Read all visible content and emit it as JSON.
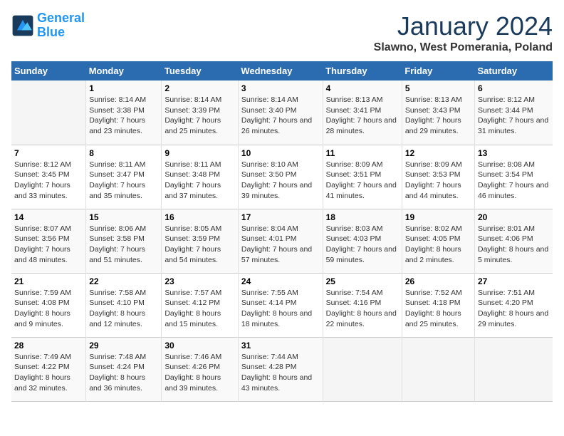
{
  "logo": {
    "line1": "General",
    "line2": "Blue"
  },
  "title": "January 2024",
  "location": "Slawno, West Pomerania, Poland",
  "days_of_week": [
    "Sunday",
    "Monday",
    "Tuesday",
    "Wednesday",
    "Thursday",
    "Friday",
    "Saturday"
  ],
  "weeks": [
    [
      {
        "day": "",
        "sunrise": "",
        "sunset": "",
        "daylight": ""
      },
      {
        "day": "1",
        "sunrise": "Sunrise: 8:14 AM",
        "sunset": "Sunset: 3:38 PM",
        "daylight": "Daylight: 7 hours and 23 minutes."
      },
      {
        "day": "2",
        "sunrise": "Sunrise: 8:14 AM",
        "sunset": "Sunset: 3:39 PM",
        "daylight": "Daylight: 7 hours and 25 minutes."
      },
      {
        "day": "3",
        "sunrise": "Sunrise: 8:14 AM",
        "sunset": "Sunset: 3:40 PM",
        "daylight": "Daylight: 7 hours and 26 minutes."
      },
      {
        "day": "4",
        "sunrise": "Sunrise: 8:13 AM",
        "sunset": "Sunset: 3:41 PM",
        "daylight": "Daylight: 7 hours and 28 minutes."
      },
      {
        "day": "5",
        "sunrise": "Sunrise: 8:13 AM",
        "sunset": "Sunset: 3:43 PM",
        "daylight": "Daylight: 7 hours and 29 minutes."
      },
      {
        "day": "6",
        "sunrise": "Sunrise: 8:12 AM",
        "sunset": "Sunset: 3:44 PM",
        "daylight": "Daylight: 7 hours and 31 minutes."
      }
    ],
    [
      {
        "day": "7",
        "sunrise": "Sunrise: 8:12 AM",
        "sunset": "Sunset: 3:45 PM",
        "daylight": "Daylight: 7 hours and 33 minutes."
      },
      {
        "day": "8",
        "sunrise": "Sunrise: 8:11 AM",
        "sunset": "Sunset: 3:47 PM",
        "daylight": "Daylight: 7 hours and 35 minutes."
      },
      {
        "day": "9",
        "sunrise": "Sunrise: 8:11 AM",
        "sunset": "Sunset: 3:48 PM",
        "daylight": "Daylight: 7 hours and 37 minutes."
      },
      {
        "day": "10",
        "sunrise": "Sunrise: 8:10 AM",
        "sunset": "Sunset: 3:50 PM",
        "daylight": "Daylight: 7 hours and 39 minutes."
      },
      {
        "day": "11",
        "sunrise": "Sunrise: 8:09 AM",
        "sunset": "Sunset: 3:51 PM",
        "daylight": "Daylight: 7 hours and 41 minutes."
      },
      {
        "day": "12",
        "sunrise": "Sunrise: 8:09 AM",
        "sunset": "Sunset: 3:53 PM",
        "daylight": "Daylight: 7 hours and 44 minutes."
      },
      {
        "day": "13",
        "sunrise": "Sunrise: 8:08 AM",
        "sunset": "Sunset: 3:54 PM",
        "daylight": "Daylight: 7 hours and 46 minutes."
      }
    ],
    [
      {
        "day": "14",
        "sunrise": "Sunrise: 8:07 AM",
        "sunset": "Sunset: 3:56 PM",
        "daylight": "Daylight: 7 hours and 48 minutes."
      },
      {
        "day": "15",
        "sunrise": "Sunrise: 8:06 AM",
        "sunset": "Sunset: 3:58 PM",
        "daylight": "Daylight: 7 hours and 51 minutes."
      },
      {
        "day": "16",
        "sunrise": "Sunrise: 8:05 AM",
        "sunset": "Sunset: 3:59 PM",
        "daylight": "Daylight: 7 hours and 54 minutes."
      },
      {
        "day": "17",
        "sunrise": "Sunrise: 8:04 AM",
        "sunset": "Sunset: 4:01 PM",
        "daylight": "Daylight: 7 hours and 57 minutes."
      },
      {
        "day": "18",
        "sunrise": "Sunrise: 8:03 AM",
        "sunset": "Sunset: 4:03 PM",
        "daylight": "Daylight: 7 hours and 59 minutes."
      },
      {
        "day": "19",
        "sunrise": "Sunrise: 8:02 AM",
        "sunset": "Sunset: 4:05 PM",
        "daylight": "Daylight: 8 hours and 2 minutes."
      },
      {
        "day": "20",
        "sunrise": "Sunrise: 8:01 AM",
        "sunset": "Sunset: 4:06 PM",
        "daylight": "Daylight: 8 hours and 5 minutes."
      }
    ],
    [
      {
        "day": "21",
        "sunrise": "Sunrise: 7:59 AM",
        "sunset": "Sunset: 4:08 PM",
        "daylight": "Daylight: 8 hours and 9 minutes."
      },
      {
        "day": "22",
        "sunrise": "Sunrise: 7:58 AM",
        "sunset": "Sunset: 4:10 PM",
        "daylight": "Daylight: 8 hours and 12 minutes."
      },
      {
        "day": "23",
        "sunrise": "Sunrise: 7:57 AM",
        "sunset": "Sunset: 4:12 PM",
        "daylight": "Daylight: 8 hours and 15 minutes."
      },
      {
        "day": "24",
        "sunrise": "Sunrise: 7:55 AM",
        "sunset": "Sunset: 4:14 PM",
        "daylight": "Daylight: 8 hours and 18 minutes."
      },
      {
        "day": "25",
        "sunrise": "Sunrise: 7:54 AM",
        "sunset": "Sunset: 4:16 PM",
        "daylight": "Daylight: 8 hours and 22 minutes."
      },
      {
        "day": "26",
        "sunrise": "Sunrise: 7:52 AM",
        "sunset": "Sunset: 4:18 PM",
        "daylight": "Daylight: 8 hours and 25 minutes."
      },
      {
        "day": "27",
        "sunrise": "Sunrise: 7:51 AM",
        "sunset": "Sunset: 4:20 PM",
        "daylight": "Daylight: 8 hours and 29 minutes."
      }
    ],
    [
      {
        "day": "28",
        "sunrise": "Sunrise: 7:49 AM",
        "sunset": "Sunset: 4:22 PM",
        "daylight": "Daylight: 8 hours and 32 minutes."
      },
      {
        "day": "29",
        "sunrise": "Sunrise: 7:48 AM",
        "sunset": "Sunset: 4:24 PM",
        "daylight": "Daylight: 8 hours and 36 minutes."
      },
      {
        "day": "30",
        "sunrise": "Sunrise: 7:46 AM",
        "sunset": "Sunset: 4:26 PM",
        "daylight": "Daylight: 8 hours and 39 minutes."
      },
      {
        "day": "31",
        "sunrise": "Sunrise: 7:44 AM",
        "sunset": "Sunset: 4:28 PM",
        "daylight": "Daylight: 8 hours and 43 minutes."
      },
      {
        "day": "",
        "sunrise": "",
        "sunset": "",
        "daylight": ""
      },
      {
        "day": "",
        "sunrise": "",
        "sunset": "",
        "daylight": ""
      },
      {
        "day": "",
        "sunrise": "",
        "sunset": "",
        "daylight": ""
      }
    ]
  ]
}
